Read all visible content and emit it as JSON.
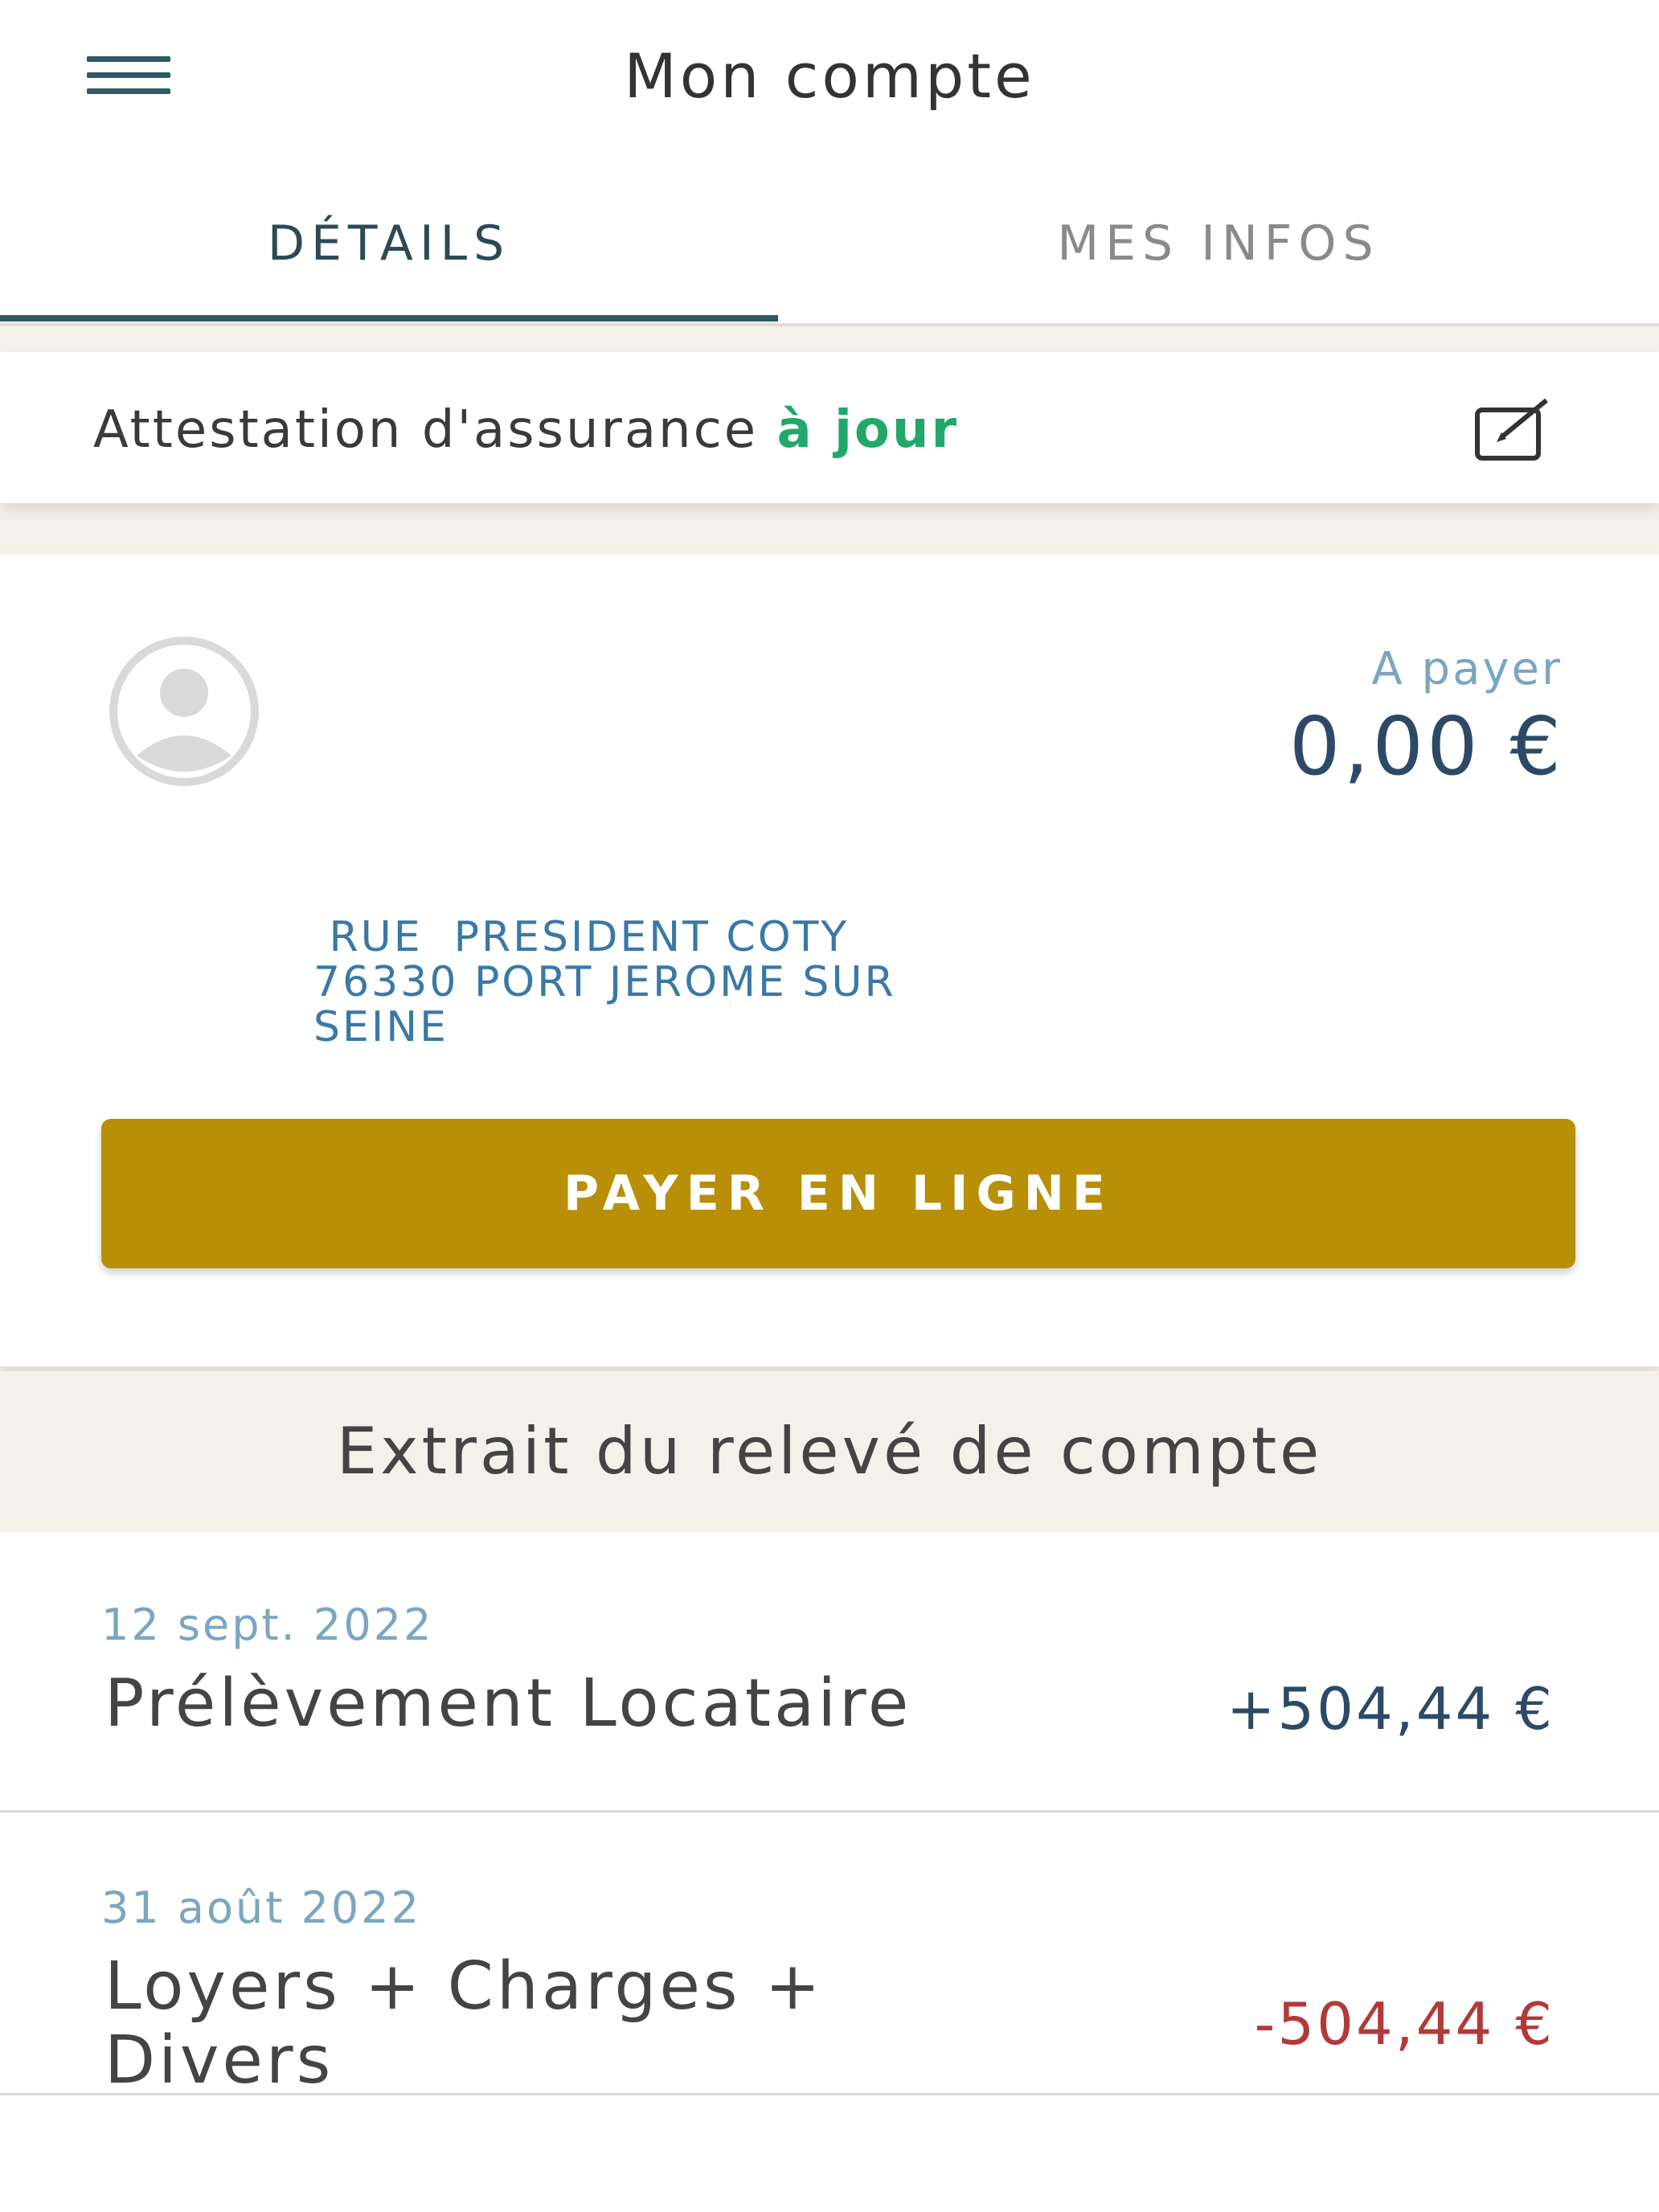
{
  "header": {
    "title": "Mon compte",
    "menu_icon": "hamburger-menu-icon"
  },
  "tabs": [
    {
      "label": "DÉTAILS",
      "active": true
    },
    {
      "label": "MES INFOS",
      "active": false
    }
  ],
  "attestation": {
    "label": "Attestation d'assurance",
    "status": "à jour",
    "status_color": "#21a86a",
    "edit_icon": "edit-icon"
  },
  "account": {
    "avatar_icon": "avatar-icon",
    "pay_label": "A payer",
    "pay_amount": "0,00 €",
    "address_line1": " RUE  PRESIDENT COTY",
    "address_line2": "76330 PORT JEROME SUR",
    "address_line3": "SEINE",
    "pay_button": "PAYER EN LIGNE",
    "button_color": "#b88f06"
  },
  "statement": {
    "title": "Extrait du relevé de compte",
    "rows": [
      {
        "date": "12 sept. 2022",
        "label": "Prélèvement Locataire",
        "amount": "+504,44 €",
        "amount_color": "#2c4a66"
      },
      {
        "date": "31 août 2022",
        "label_line1": "Loyers + Charges +",
        "label_line2": "Divers",
        "amount": "-504,44 €",
        "amount_color": "#b03a3a"
      }
    ]
  }
}
